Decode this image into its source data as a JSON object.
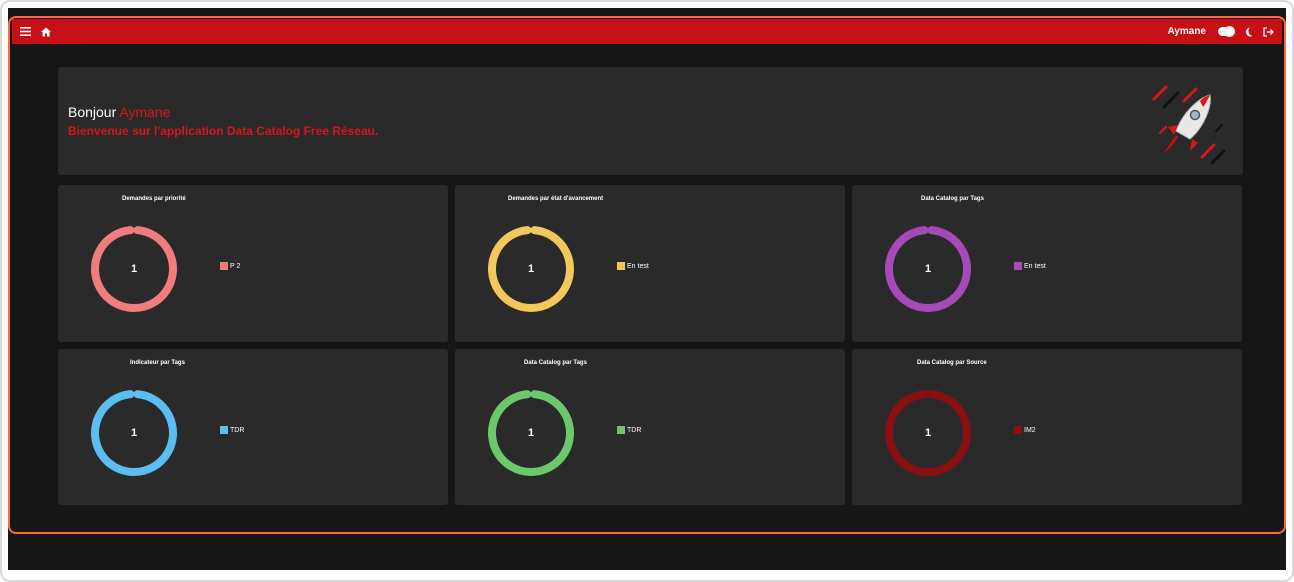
{
  "header": {
    "username": "Aymane",
    "icons": [
      "menu-icon",
      "home-icon",
      "theme-toggle",
      "moon-icon",
      "logout-icon"
    ]
  },
  "welcome": {
    "greeting": "Bonjour",
    "name": "Aymane",
    "subtitle": "Bienvenue sur l'application Data Catalog Free Réseau."
  },
  "cards": [
    {
      "title": "Demandes par priorité",
      "value": "1",
      "legend": "P 2",
      "color": "#f07c7c"
    },
    {
      "title": "Demandes par état d'avancement",
      "value": "1",
      "legend": "En test",
      "color": "#f2c75c"
    },
    {
      "title": "Data Catalog par Tags",
      "value": "1",
      "legend": "En test",
      "color": "#a64ab8"
    },
    {
      "title": "Indicateur par Tags",
      "value": "1",
      "legend": "TDR",
      "color": "#5bbdf0"
    },
    {
      "title": "Data Catalog par Tags",
      "value": "1",
      "legend": "TDR",
      "color": "#6bc96b"
    },
    {
      "title": "Data Catalog par Source",
      "value": "1",
      "legend": "IM2",
      "color": "#8b0f12"
    }
  ],
  "colors": {
    "brand": "#c70f16",
    "accent_text": "#d6161e",
    "focus_border": "#ff6a3a",
    "card_bg": "#2a2a2a",
    "page_bg": "#161616"
  }
}
